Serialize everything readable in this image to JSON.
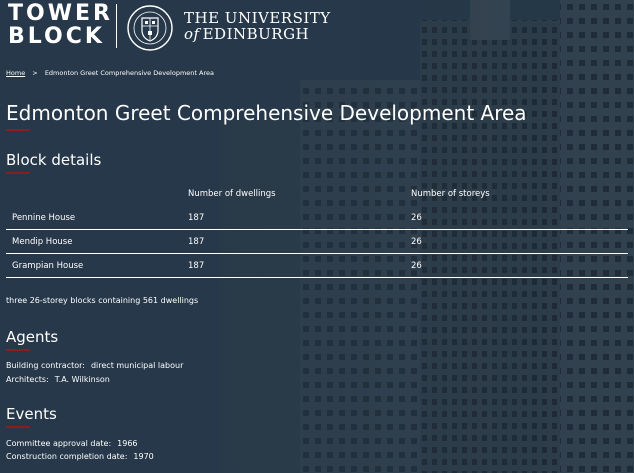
{
  "header": {
    "logo_line1": "TOWER",
    "logo_line2": "BLOCK",
    "university_line1": "THE UNIVERSITY",
    "university_of": "of",
    "university_line2": "EDINBURGH"
  },
  "breadcrumb": {
    "home": "Home",
    "separator": ">",
    "current": "Edmonton Greet Comprehensive Development Area"
  },
  "page_title": "Edmonton Greet Comprehensive Development Area",
  "block_details": {
    "heading": "Block details",
    "columns": [
      "",
      "Number of dwellings",
      "Number of storeys"
    ],
    "rows": [
      {
        "name": "Pennine House",
        "dwellings": "187",
        "storeys": "26"
      },
      {
        "name": "Mendip House",
        "dwellings": "187",
        "storeys": "26"
      },
      {
        "name": "Grampian House",
        "dwellings": "187",
        "storeys": "26"
      }
    ],
    "summary": "three 26-storey blocks containing 561 dwellings"
  },
  "agents": {
    "heading": "Agents",
    "items": [
      {
        "label": "Building contractor:",
        "value": "direct municipal labour"
      },
      {
        "label": "Architects:",
        "value": "T.A. Wilkinson"
      }
    ]
  },
  "events": {
    "heading": "Events",
    "items": [
      {
        "label": "Committee approval date:",
        "value": "1966"
      },
      {
        "label": "Construction completion date:",
        "value": "1970"
      }
    ]
  },
  "colors": {
    "accent_underline": "#8a1d1d",
    "text": "#ffffff",
    "background": "#23343f"
  }
}
